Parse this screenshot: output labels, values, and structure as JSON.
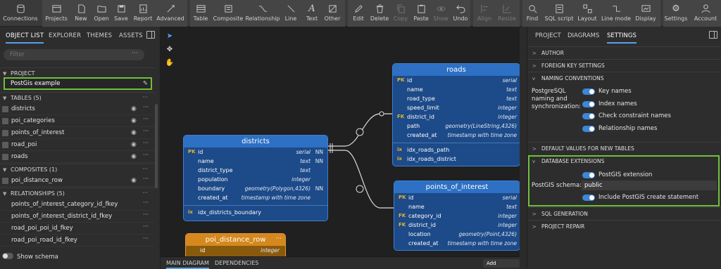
{
  "toolbar": {
    "buttons": [
      {
        "label": "Connections",
        "icon": "database-icon"
      },
      {
        "label": "Projects",
        "icon": "folder-grid-icon"
      },
      {
        "label": "New",
        "icon": "new-file-icon"
      },
      {
        "label": "Open",
        "icon": "folder-open-icon"
      },
      {
        "label": "Save",
        "icon": "save-icon"
      },
      {
        "label": "Report",
        "icon": "report-icon"
      },
      {
        "label": "Advanced",
        "icon": "advanced-icon"
      },
      {
        "label": "Table",
        "icon": "table-icon"
      },
      {
        "label": "Composite",
        "icon": "composite-icon"
      },
      {
        "label": "Relationship",
        "icon": "relationship-icon"
      },
      {
        "label": "Line",
        "icon": "line-icon"
      },
      {
        "label": "Text",
        "icon": "text-icon"
      },
      {
        "label": "Other",
        "icon": "other-icon"
      },
      {
        "label": "Edit",
        "icon": "edit-icon"
      },
      {
        "label": "Delete",
        "icon": "trash-icon"
      },
      {
        "label": "Copy",
        "icon": "copy-icon"
      },
      {
        "label": "Paste",
        "icon": "paste-icon"
      },
      {
        "label": "Show",
        "icon": "eye-icon"
      },
      {
        "label": "Undo",
        "icon": "undo-icon"
      },
      {
        "label": "Align",
        "icon": "align-icon"
      },
      {
        "label": "Resize",
        "icon": "resize-icon"
      },
      {
        "label": "Find",
        "icon": "search-icon"
      },
      {
        "label": "SQL script",
        "icon": "sql-script-icon"
      },
      {
        "label": "Layout",
        "icon": "layout-icon"
      },
      {
        "label": "Line mode",
        "icon": "line-mode-icon"
      },
      {
        "label": "Display",
        "icon": "display-icon"
      },
      {
        "label": "Settings",
        "icon": "gear-icon"
      },
      {
        "label": "Account",
        "icon": "user-icon"
      }
    ]
  },
  "left": {
    "tabs": [
      "OBJECT LIST",
      "EXPLORER",
      "THEMES",
      "ASSETS"
    ],
    "filter_placeholder": "Filter",
    "project_header": "PROJECT",
    "project_name": "PostGis example",
    "tables_header": "TABLES",
    "tables_count": "(5)",
    "tables": [
      "districts",
      "poi_categories",
      "points_of_interest",
      "road_poi",
      "roads"
    ],
    "composites_header": "COMPOSITES",
    "composites_count": "(1)",
    "composites": [
      "poi_distance_row"
    ],
    "relationships_header": "RELATIONSHIPS",
    "relationships_count": "(5)",
    "relationships": [
      "points_of_interest_category_id_fkey",
      "points_of_interest_district_id_fkey",
      "road_poi_poi_id_fkey",
      "road_poi_road_id_fkey"
    ],
    "show_schema": "Show schema"
  },
  "canvas": {
    "tables": {
      "roads": {
        "name": "roads",
        "columns": [
          {
            "key": "pk",
            "name": "id",
            "type": "serial",
            "nn": ""
          },
          {
            "key": "",
            "name": "name",
            "type": "text",
            "nn": ""
          },
          {
            "key": "",
            "name": "road_type",
            "type": "text",
            "nn": ""
          },
          {
            "key": "",
            "name": "speed_limit",
            "type": "integer",
            "nn": ""
          },
          {
            "key": "fk",
            "name": "district_id",
            "type": "integer",
            "nn": ""
          },
          {
            "key": "",
            "name": "path",
            "type": "geometry(LineString,4326)",
            "nn": ""
          },
          {
            "key": "",
            "name": "created_at",
            "type": "timestamp with time zone",
            "nn": ""
          }
        ],
        "indexes": [
          "idx_roads_path",
          "idx_roads_district"
        ]
      },
      "districts": {
        "name": "districts",
        "columns": [
          {
            "key": "pk",
            "name": "id",
            "type": "serial",
            "nn": "NN"
          },
          {
            "key": "",
            "name": "name",
            "type": "text",
            "nn": "NN"
          },
          {
            "key": "",
            "name": "district_type",
            "type": "text",
            "nn": ""
          },
          {
            "key": "",
            "name": "population",
            "type": "integer",
            "nn": ""
          },
          {
            "key": "",
            "name": "boundary",
            "type": "geometry(Polygon,4326)",
            "nn": "NN"
          },
          {
            "key": "",
            "name": "created_at",
            "type": "timestamp with time zone",
            "nn": ""
          }
        ],
        "indexes": [
          "idx_districts_boundary"
        ]
      },
      "poi": {
        "name": "points_of_interest",
        "columns": [
          {
            "key": "pk",
            "name": "id",
            "type": "serial",
            "nn": ""
          },
          {
            "key": "",
            "name": "name",
            "type": "text",
            "nn": ""
          },
          {
            "key": "fk",
            "name": "category_id",
            "type": "integer",
            "nn": ""
          },
          {
            "key": "fk",
            "name": "district_id",
            "type": "integer",
            "nn": ""
          },
          {
            "key": "",
            "name": "location",
            "type": "geometry(Point,4326)",
            "nn": ""
          },
          {
            "key": "",
            "name": "created_at",
            "type": "timestamp with time zone",
            "nn": ""
          }
        ]
      },
      "pdr": {
        "name": "poi_distance_row",
        "columns": [
          {
            "key": "",
            "name": "id",
            "type": "integer",
            "nn": ""
          }
        ]
      }
    },
    "key_labels": {
      "pk": "PK",
      "fk": "FK",
      "ix": "ix"
    },
    "bottom_tabs": [
      "MAIN DIAGRAM",
      "DEPENDENCIES"
    ],
    "add_diagram": "Add diagram"
  },
  "right": {
    "tabs": [
      "PROJECT",
      "DIAGRAMS",
      "SETTINGS"
    ],
    "sections": {
      "author": "AUTHOR",
      "fk_settings": "FOREIGN KEY SETTINGS",
      "naming": "NAMING CONVENTIONS",
      "defaults": "DEFAULT VALUES FOR NEW TABLES",
      "dbext": "DATABASE EXTENSIONS",
      "sqlgen": "SQL GENERATION",
      "repair": "PROJECT REPAIR"
    },
    "naming_label": "PostgreSQL naming and synchronization:",
    "naming_toggles": [
      "Key names",
      "Index names",
      "Check constraint names",
      "Relationship names"
    ],
    "postgis_extension": "PostGIS extension",
    "postgis_schema_label": "PostGIS schema:",
    "postgis_schema_value": "public",
    "include_create": "Include PostGIS create statement"
  }
}
